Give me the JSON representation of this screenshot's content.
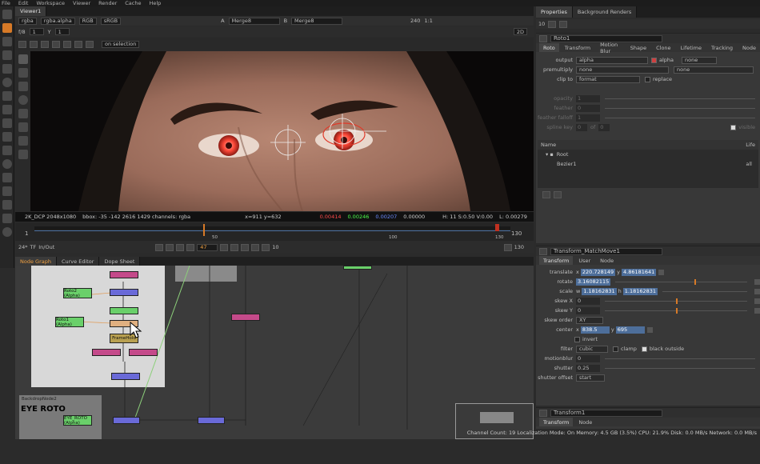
{
  "menu": [
    "File",
    "Edit",
    "Workspace",
    "Viewer",
    "Render",
    "Cache",
    "Help"
  ],
  "viewer": {
    "tab_label": "Viewer1",
    "channels": "rgba",
    "alpha": "rgba.alpha",
    "rgb": "RGB",
    "colorspace": "sRGB",
    "input_a": "A",
    "node_a": "Merge8",
    "input_b": "B",
    "node_b": "Merge8",
    "fps": "240",
    "ratio": "1:1",
    "fstop": "f/8",
    "frame": "1",
    "y_label": "Y",
    "y_value": "1",
    "mode": "2D",
    "on_selection": "on selection",
    "info": {
      "format": "2K_DCP 2048x1080",
      "bbox": "bbox: -35 -142 2616 1429 channels: rgba",
      "coords": "x=911 y=632",
      "r": "0.00414",
      "g": "0.00246",
      "b": "0.00207",
      "a": "0.00000",
      "hsvl": "H: 11 S:0.50 V:0.00",
      "l": "L: 0.00279"
    }
  },
  "timeline": {
    "start": "1",
    "end": "130",
    "ticks": [
      "1",
      "50",
      "100",
      "130"
    ],
    "fps": "24*",
    "tf": "TF",
    "inout": "In/Out",
    "current_frame": "47",
    "step": "10",
    "end_frame": "130"
  },
  "nodegraph": {
    "tabs": [
      "Node Graph",
      "Curve Editor",
      "Dope Sheet"
    ],
    "backdrop_label": "BackdropNode2",
    "backdrop_title": "EYE ROTO",
    "nodes": {
      "roto2": "Roto2 (Alpha)",
      "roto1": "Roto1 (Alpha)",
      "eye_roto": "EYE_ROTO (Alpha)",
      "framehold": "FrameHold"
    }
  },
  "status": "Channel Count: 19  Localization Mode: On  Memory: 4.5 GB (3.5%)  CPU: 21.9%  Disk: 0.0 MB/s  Network: 0.0 MB/s",
  "properties": {
    "tabs": [
      "Properties",
      "Background Renders"
    ],
    "max_panels": "10",
    "roto": {
      "name": "Roto1",
      "tabs": [
        "Roto",
        "Transform",
        "Motion Blur",
        "Shape",
        "Clone",
        "Lifetime",
        "Tracking",
        "Node"
      ],
      "output_label": "output",
      "output_value": "alpha",
      "alpha_label": "alpha",
      "none": "none",
      "premultiply_label": "premultiply",
      "premultiply_value": "none",
      "clip_label": "clip to",
      "clip_value": "format",
      "replace_label": "replace",
      "opacity_label": "opacity",
      "opacity_value": "1",
      "feather_label": "feather",
      "feather_value": "0",
      "falloff_label": "feather falloff",
      "falloff_value": "1",
      "spline_label": "spline key",
      "spline_value": "0",
      "spline_of": "of",
      "spline_total": "0",
      "visible_label": "visible",
      "tree_cols": [
        "Name",
        "Life"
      ],
      "tree_root": "Root",
      "tree_child": "Bezier1",
      "tree_life": "all"
    },
    "transform_mm": {
      "name": "Transform_MatchMove1",
      "tabs": [
        "Transform",
        "User",
        "Node"
      ],
      "translate_label": "translate",
      "translate_x": "220.728149",
      "translate_y": "4.86181641",
      "rotate_label": "rotate",
      "rotate_value": "3.16082115",
      "scale_label": "scale",
      "scale_w": "1.18162831",
      "scale_h": "1.18162831",
      "skewx_label": "skew X",
      "skewx_value": "0",
      "skewy_label": "skew Y",
      "skewy_value": "0",
      "skeworder_label": "skew order",
      "skeworder_value": "XY",
      "center_label": "center",
      "center_x": "838.5",
      "center_y": "695",
      "invert_label": "invert",
      "filter_label": "filter",
      "filter_value": "cubic",
      "clamp_label": "clamp",
      "blackoutside_label": "black outside",
      "motionblur_label": "motionblur",
      "motionblur_value": "0",
      "shutter_label": "shutter",
      "shutter_value": "0.25",
      "shutteroffset_label": "shutter offset",
      "shutteroffset_value": "start"
    },
    "transform1": {
      "name": "Transform1",
      "tabs": [
        "Transform",
        "Node"
      ]
    }
  }
}
